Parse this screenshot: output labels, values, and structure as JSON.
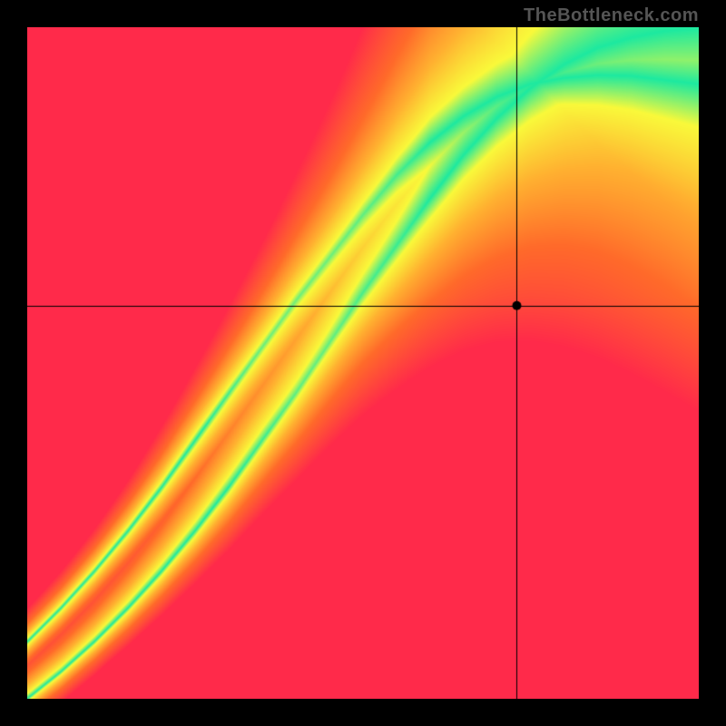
{
  "watermark": "TheBottleneck.com",
  "chart_data": {
    "type": "heatmap",
    "title": "",
    "xlabel": "",
    "ylabel": "",
    "xlim": [
      0,
      1
    ],
    "ylim": [
      0,
      1
    ],
    "crosshair": {
      "x": 0.73,
      "y": 0.585
    },
    "marker": {
      "x": 0.73,
      "y": 0.585
    },
    "ridge": [
      {
        "x": 0.0,
        "y": 0.0
      },
      {
        "x": 0.05,
        "y": 0.04
      },
      {
        "x": 0.1,
        "y": 0.085
      },
      {
        "x": 0.15,
        "y": 0.135
      },
      {
        "x": 0.2,
        "y": 0.19
      },
      {
        "x": 0.25,
        "y": 0.25
      },
      {
        "x": 0.3,
        "y": 0.315
      },
      {
        "x": 0.35,
        "y": 0.385
      },
      {
        "x": 0.4,
        "y": 0.455
      },
      {
        "x": 0.45,
        "y": 0.53
      },
      {
        "x": 0.5,
        "y": 0.605
      },
      {
        "x": 0.55,
        "y": 0.675
      },
      {
        "x": 0.6,
        "y": 0.745
      },
      {
        "x": 0.65,
        "y": 0.81
      },
      {
        "x": 0.7,
        "y": 0.865
      },
      {
        "x": 0.75,
        "y": 0.91
      },
      {
        "x": 0.8,
        "y": 0.945
      },
      {
        "x": 0.85,
        "y": 0.97
      },
      {
        "x": 0.9,
        "y": 0.985
      },
      {
        "x": 0.95,
        "y": 0.995
      },
      {
        "x": 1.0,
        "y": 1.0
      }
    ],
    "colors": {
      "peak": "#1de9a0",
      "high": "#f9f93a",
      "mid": "#ffb030",
      "low": "#ff6a2a",
      "bottom": "#ff2a4a"
    },
    "value_note": "Heatmap coloring encodes closeness to the ridge curve; green = best match, yellow/orange = moderate, red = poor."
  }
}
